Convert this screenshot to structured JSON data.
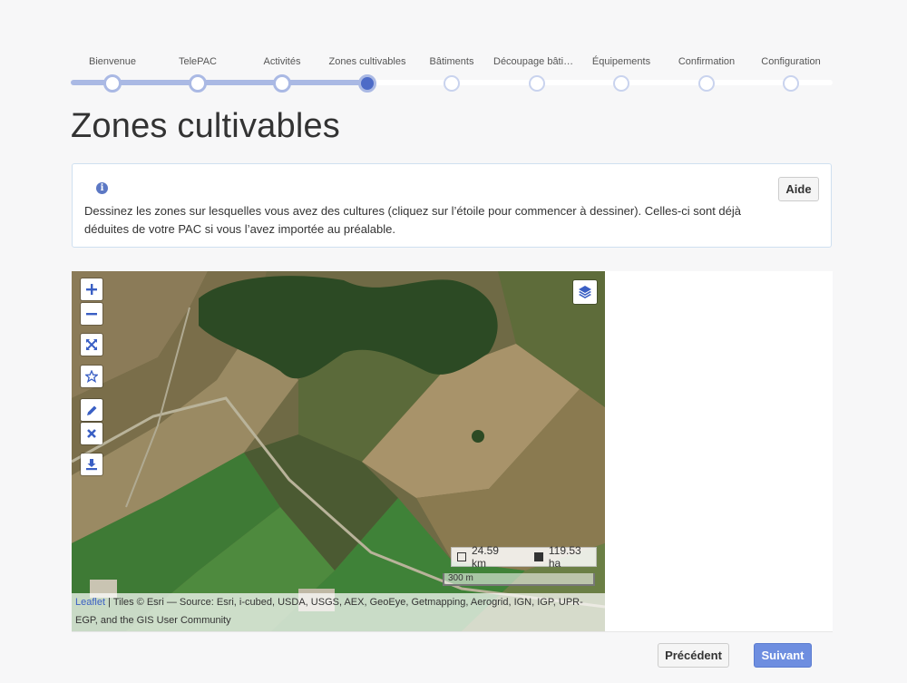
{
  "stepper": {
    "steps": [
      {
        "label": "Bienvenue",
        "state": "done"
      },
      {
        "label": "TelePAC",
        "state": "done"
      },
      {
        "label": "Activités",
        "state": "done"
      },
      {
        "label": "Zones cultivables",
        "state": "active"
      },
      {
        "label": "Bâtiments",
        "state": "pending"
      },
      {
        "label": "Découpage bâtiments",
        "state": "pending"
      },
      {
        "label": "Équipements",
        "state": "pending"
      },
      {
        "label": "Confirmation",
        "state": "pending"
      },
      {
        "label": "Configuration",
        "state": "pending"
      }
    ]
  },
  "page": {
    "title": "Zones cultivables"
  },
  "info": {
    "icon": "info-icon",
    "text": "Dessinez les zones sur lesquelles vous avez des cultures (cliquez sur l’étoile pour commencer à dessiner). Celles-ci sont déjà déduites de votre PAC si vous l’avez importée au préalable.",
    "help_label": "Aide"
  },
  "map": {
    "controls": [
      {
        "name": "zoom-in-icon"
      },
      {
        "name": "zoom-out-icon"
      },
      {
        "name": "fullscreen-icon"
      },
      {
        "name": "star-icon"
      },
      {
        "name": "pencil-icon"
      },
      {
        "name": "delete-icon"
      },
      {
        "name": "download-icon"
      }
    ],
    "layers_icon": "layers-icon",
    "measure": {
      "perimeter": "24.59 km",
      "area": "119.53 ha"
    },
    "scale_label": "300 m",
    "attribution": {
      "link": "Leaflet",
      "separator": " | ",
      "text": "Tiles © Esri — Source: Esri, i-cubed, USDA, USGS, AEX, GeoEye, Getmapping, Aerogrid, IGN, IGP, UPR-EGP, and the GIS User Community"
    }
  },
  "footer": {
    "prev_label": "Précédent",
    "next_label": "Suivant"
  },
  "colors": {
    "accent": "#4d6bc7",
    "next_button": "#6e8ee0",
    "track_done": "#aab9e4"
  }
}
